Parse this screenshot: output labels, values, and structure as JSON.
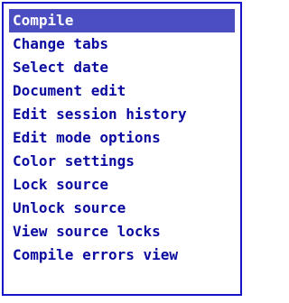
{
  "menu": {
    "selected_index": 0,
    "items": [
      {
        "label": "Compile"
      },
      {
        "label": "Change tabs"
      },
      {
        "label": "Select date"
      },
      {
        "label": "Document edit"
      },
      {
        "label": "Edit session history"
      },
      {
        "label": "Edit mode options"
      },
      {
        "label": "Color settings"
      },
      {
        "label": "Lock source"
      },
      {
        "label": "Unlock source"
      },
      {
        "label": "View source locks"
      },
      {
        "label": "Compile errors view"
      }
    ]
  },
  "colors": {
    "border": "#1414c8",
    "text": "#0a0aa0",
    "highlight_bg": "#4a4ec0",
    "highlight_text": "#ffffff",
    "background": "#ffffff"
  }
}
